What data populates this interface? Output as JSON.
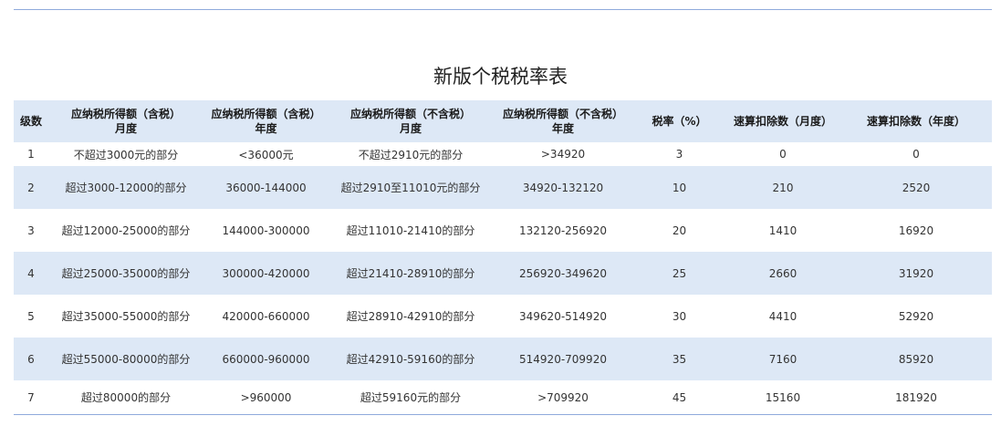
{
  "title": "新版个税税率表",
  "colors": {
    "band": "#dde8f6",
    "rule": "#8faadc"
  },
  "headers": [
    [
      "级数"
    ],
    [
      "应纳税所得额（含税）",
      "月度"
    ],
    [
      "应纳税所得额（含税）",
      "年度"
    ],
    [
      "应纳税所得额（不含税）",
      "月度"
    ],
    [
      "应纳税所得额（不含税）",
      "年度"
    ],
    [
      "税率（%）"
    ],
    [
      "速算扣除数（月度）"
    ],
    [
      "速算扣除数（年度）"
    ]
  ],
  "rows": [
    [
      "1",
      "不超过3000元的部分",
      "<36000元",
      "不超过2910元的部分",
      ">34920",
      "3",
      "0",
      "0"
    ],
    [
      "2",
      "超过3000-12000的部分",
      "36000-144000",
      "超过2910至11010元的部分",
      "34920-132120",
      "10",
      "210",
      "2520"
    ],
    [
      "3",
      "超过12000-25000的部分",
      "144000-300000",
      "超过11010-21410的部分",
      "132120-256920",
      "20",
      "1410",
      "16920"
    ],
    [
      "4",
      "超过25000-35000的部分",
      "300000-420000",
      "超过21410-28910的部分",
      "256920-349620",
      "25",
      "2660",
      "31920"
    ],
    [
      "5",
      "超过35000-55000的部分",
      "420000-660000",
      "超过28910-42910的部分",
      "349620-514920",
      "30",
      "4410",
      "52920"
    ],
    [
      "6",
      "超过55000-80000的部分",
      "660000-960000",
      "超过42910-59160的部分",
      "514920-709920",
      "35",
      "7160",
      "85920"
    ],
    [
      "7",
      "超过80000的部分",
      ">960000",
      "超过59160元的部分",
      ">709920",
      "45",
      "15160",
      "181920"
    ]
  ]
}
